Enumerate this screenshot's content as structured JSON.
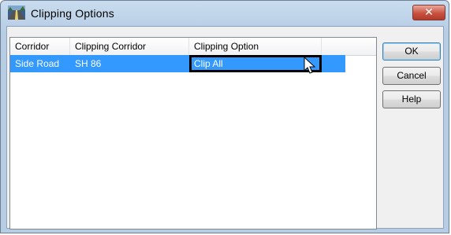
{
  "window": {
    "title": "Clipping Options",
    "close_glyph": "✕"
  },
  "list": {
    "columns": [
      "Corridor",
      "Clipping Corridor",
      "Clipping Option"
    ],
    "rows": [
      {
        "corridor": "Side Road",
        "clipping_corridor": "SH 86",
        "clipping_option": "Clip All"
      }
    ]
  },
  "buttons": {
    "ok": "OK",
    "cancel": "Cancel",
    "help": "Help"
  },
  "colors": {
    "selection": "#3399ff",
    "title_gradient": "#c9dcef",
    "close_button": "#c8523f"
  },
  "icons": {
    "title": "road-icon",
    "cursor": "mouse-pointer-icon"
  }
}
